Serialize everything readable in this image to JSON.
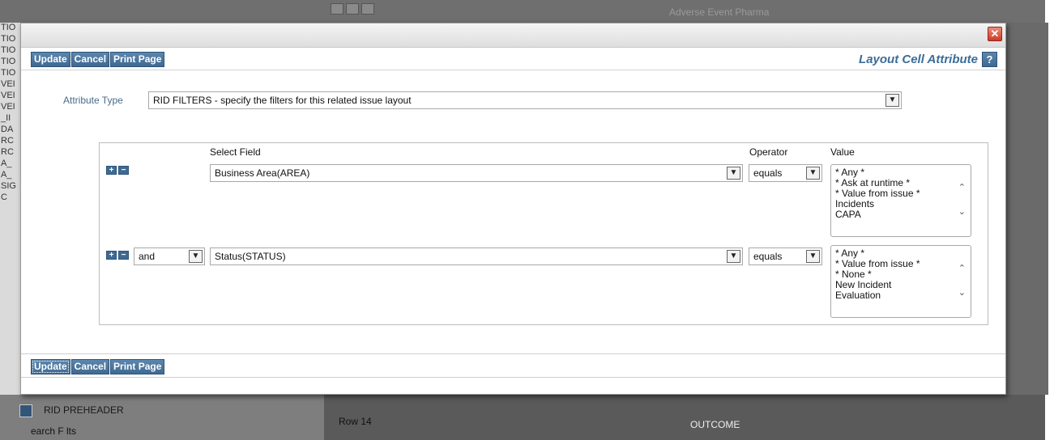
{
  "background": {
    "top_text": "Adverse Event Pharma",
    "left_column_text": [
      "TIO",
      "TIO",
      "TIO",
      "TIO",
      "TIO",
      "VEI",
      "VEI",
      "VEI",
      "_II",
      "DA",
      "RC",
      "RC",
      "A_",
      "A_",
      "SIG",
      "C"
    ],
    "bottom_label": "RID PREHEADER",
    "bottom_label2": "earch F  lts",
    "bottom_row": "Row 14",
    "bottom_outcome": "OUTCOME"
  },
  "dialog": {
    "close_glyph": "✕",
    "toolbar": {
      "update_label": "Update",
      "cancel_label": "Cancel",
      "print_label": "Print Page",
      "title": "Layout Cell Attribute",
      "help_glyph": "?"
    },
    "attribute_type": {
      "label": "Attribute Type",
      "value": "RID FILTERS - specify the filters for this related issue layout"
    },
    "filters": {
      "headers": {
        "select_field": "Select Field",
        "operator": "Operator",
        "value": "Value"
      },
      "rows": [
        {
          "connector": "",
          "field": "Business Area(AREA)",
          "operator": "equals",
          "values": [
            "* Any *",
            "* Ask at runtime *",
            "* Value from issue *",
            "Incidents",
            "CAPA"
          ]
        },
        {
          "connector": "and",
          "field": "Status(STATUS)",
          "operator": "equals",
          "values": [
            "* Any *",
            "* Value from issue *",
            "* None *",
            "New Incident",
            "Evaluation"
          ]
        }
      ]
    },
    "bottom": {
      "update_label": "Update",
      "cancel_label": "Cancel",
      "print_label": "Print Page"
    },
    "icons": {
      "dropdown": "chevron-down-icon",
      "scroll_up": "chevron-up-icon",
      "scroll_down": "chevron-down-icon",
      "plus": "plus-icon",
      "minus": "minus-icon"
    },
    "colors": {
      "button": "#3f6a92",
      "title": "#3b6d98",
      "close": "#cc3b26"
    }
  }
}
